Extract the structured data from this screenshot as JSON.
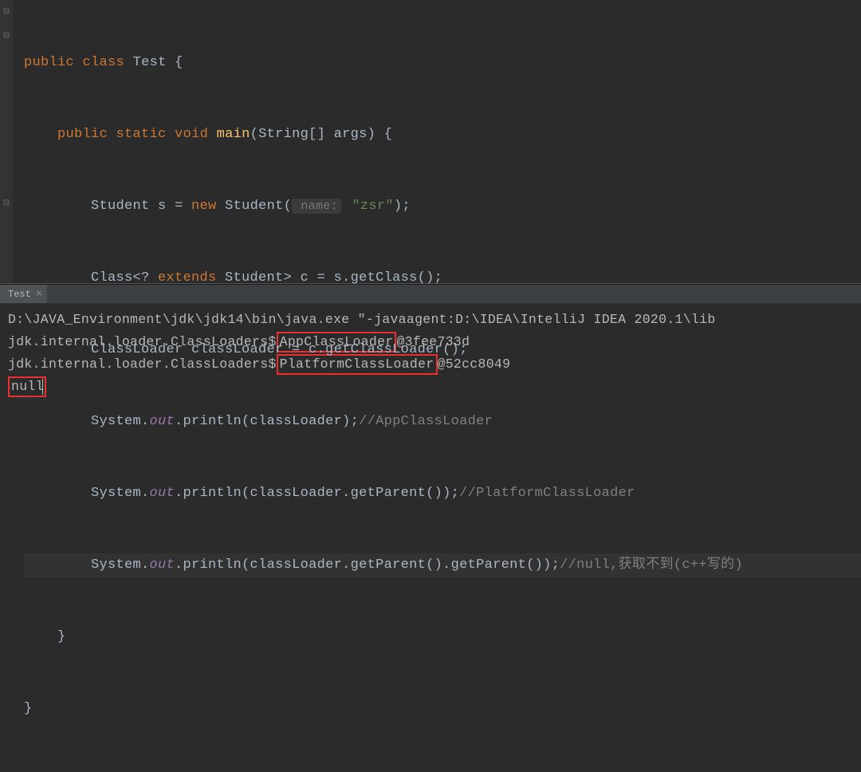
{
  "editor": {
    "line1": {
      "kw_public": "public",
      "kw_class": "class",
      "class_name": "Test",
      "brace": " {"
    },
    "line2": {
      "indent": "    ",
      "kw_public": "public",
      "kw_static": "static",
      "kw_void": "void",
      "method": "main",
      "params": "(String[] args) {"
    },
    "line3": {
      "indent": "        ",
      "part1": "Student s = ",
      "kw_new": "new",
      "ctor": " Student(",
      "hint": " name:",
      "str": "\"zsr\"",
      "end": ");"
    },
    "line4": {
      "indent": "        ",
      "text": "Class<? ",
      "kw_extends": "extends",
      "rest": " Student> c = s.getClass();"
    },
    "line5": {
      "indent": "        ",
      "text": "ClassLoader classLoader = c.getClassLoader();"
    },
    "line6": {
      "indent": "        ",
      "sys": "System.",
      "out": "out",
      "print": ".println(classLoader);",
      "comment": "//AppClassLoader"
    },
    "line7": {
      "indent": "        ",
      "sys": "System.",
      "out": "out",
      "print": ".println(classLoader.getParent());",
      "comment": "//PlatformClassLoader"
    },
    "line8": {
      "indent": "        ",
      "sys": "System.",
      "out": "out",
      "print": ".println(classLoader.getParent().getParent());",
      "comment": "//null,获取不到(c++写的)"
    },
    "line9": {
      "indent": "    ",
      "brace": "}"
    },
    "line10": {
      "brace": "}"
    }
  },
  "tab": {
    "label": "Test",
    "close": "×"
  },
  "console": {
    "line1": "D:\\JAVA_Environment\\jdk\\jdk14\\bin\\java.exe \"-javaagent:D:\\IDEA\\IntelliJ IDEA 2020.1\\lib",
    "line2_pre": "jdk.internal.loader.ClassLoaders$",
    "line2_hl": "AppClassLoader",
    "line2_post": "@3fee733d",
    "line3_pre": "jdk.internal.loader.ClassLoaders$",
    "line3_hl": "PlatformClassLoader",
    "line3_post": "@52cc8049",
    "line4_hl": "null"
  },
  "gutter": {
    "fold1": "⊟",
    "fold2": "⊟",
    "fold3": "⊟"
  }
}
